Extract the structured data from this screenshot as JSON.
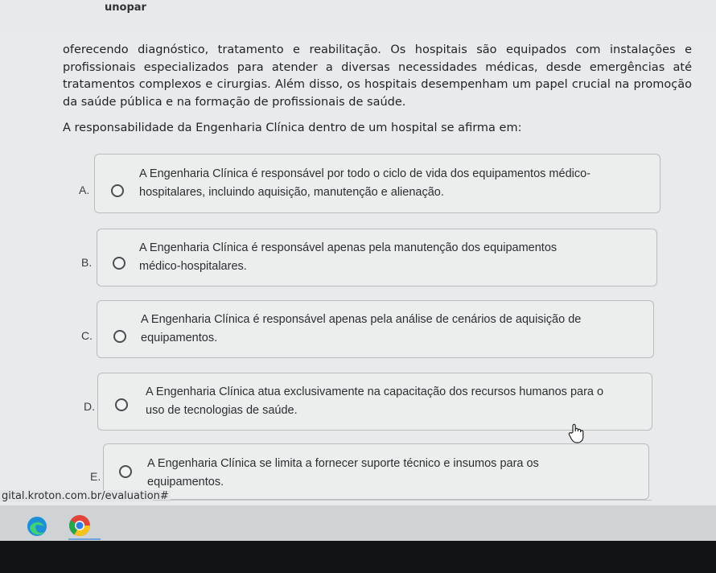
{
  "header": {
    "brand": "unopar"
  },
  "body": {
    "paragraph": "oferecendo diagnóstico, tratamento e reabilitação. Os hospitais são equipados com instalações e profissionais especializados para atender a diversas necessidades médicas, desde emergências até tratamentos complexos e cirurgias. Além disso, os hospitais desempenham um papel crucial na promoção da saúde pública e na formação de profissionais de saúde.",
    "question": "A responsabilidade da Engenharia Clínica dentro de um hospital se afirma em:"
  },
  "options": [
    {
      "letter": "A.",
      "line1": "A Engenharia Clínica é responsável por todo o ciclo de vida dos equipamentos médico-",
      "line2": "hospitalares, incluindo aquisição, manutenção e alienação."
    },
    {
      "letter": "B.",
      "line1": "A Engenharia Clínica é responsável apenas pela manutenção dos equipamentos",
      "line2": "médico-hospitalares."
    },
    {
      "letter": "C.",
      "line1": "A Engenharia Clínica é responsável apenas pela análise de cenários de aquisição de",
      "line2": "equipamentos."
    },
    {
      "letter": "D.",
      "line1": "A Engenharia Clínica atua exclusivamente na capacitação dos recursos humanos para o",
      "line2": "uso de tecnologias de saúde."
    },
    {
      "letter": "E.",
      "line1": "A Engenharia Clínica se limita a fornecer suporte técnico e insumos para os",
      "line2": "equipamentos."
    }
  ],
  "status": {
    "url": "gital.kroton.com.br/evaluation#"
  },
  "shelf_icons": [
    "edge-browser-icon",
    "chrome-browser-icon"
  ]
}
